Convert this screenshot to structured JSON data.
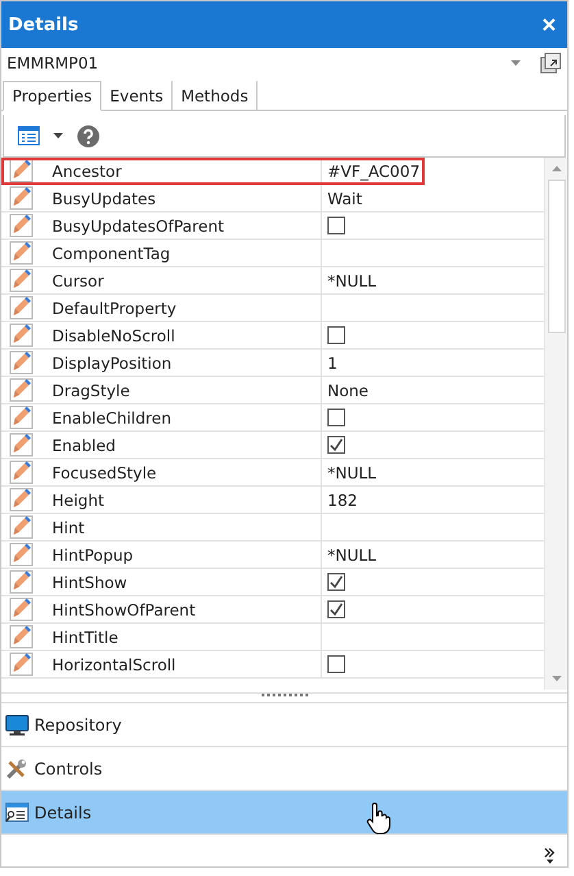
{
  "window": {
    "title": "Details",
    "close": "×"
  },
  "object_selector": {
    "value": "EMMRMP01"
  },
  "tabs": [
    {
      "label": "Properties",
      "selected": true
    },
    {
      "label": "Events",
      "selected": false
    },
    {
      "label": "Methods",
      "selected": false
    }
  ],
  "properties": [
    {
      "name": "Ancestor",
      "kind": "text",
      "value": "#VF_AC007",
      "highlighted": true
    },
    {
      "name": "BusyUpdates",
      "kind": "text",
      "value": "Wait",
      "highlighted": false
    },
    {
      "name": "BusyUpdatesOfParent",
      "kind": "check",
      "checked": false,
      "highlighted": false
    },
    {
      "name": "ComponentTag",
      "kind": "empty",
      "highlighted": false
    },
    {
      "name": "Cursor",
      "kind": "text",
      "value": "*NULL",
      "highlighted": false
    },
    {
      "name": "DefaultProperty",
      "kind": "empty",
      "highlighted": false
    },
    {
      "name": "DisableNoScroll",
      "kind": "check",
      "checked": false,
      "highlighted": false
    },
    {
      "name": "DisplayPosition",
      "kind": "text",
      "value": "1",
      "highlighted": false
    },
    {
      "name": "DragStyle",
      "kind": "text",
      "value": "None",
      "highlighted": false
    },
    {
      "name": "EnableChildren",
      "kind": "check",
      "checked": false,
      "highlighted": false
    },
    {
      "name": "Enabled",
      "kind": "check",
      "checked": true,
      "highlighted": false
    },
    {
      "name": "FocusedStyle",
      "kind": "text",
      "value": "*NULL",
      "highlighted": false
    },
    {
      "name": "Height",
      "kind": "text",
      "value": "182",
      "highlighted": false
    },
    {
      "name": "Hint",
      "kind": "empty",
      "highlighted": false
    },
    {
      "name": "HintPopup",
      "kind": "text",
      "value": "*NULL",
      "highlighted": false
    },
    {
      "name": "HintShow",
      "kind": "check",
      "checked": true,
      "highlighted": false
    },
    {
      "name": "HintShowOfParent",
      "kind": "check",
      "checked": true,
      "highlighted": false
    },
    {
      "name": "HintTitle",
      "kind": "empty",
      "highlighted": false
    },
    {
      "name": "HorizontalScroll",
      "kind": "check",
      "checked": false,
      "highlighted": false
    }
  ],
  "navigation": [
    {
      "label": "Repository",
      "kind": "monitor",
      "selected": false
    },
    {
      "label": "Controls",
      "kind": "tools",
      "selected": false
    },
    {
      "label": "Details",
      "kind": "details",
      "selected": true
    }
  ]
}
